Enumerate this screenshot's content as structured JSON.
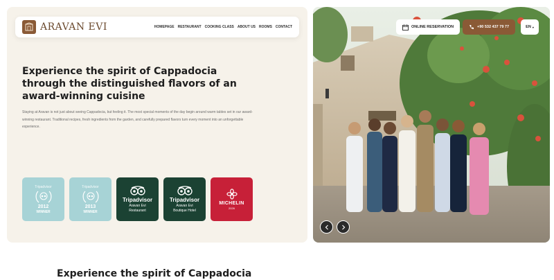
{
  "brand": {
    "name": "ARAVAN EVI"
  },
  "nav": {
    "links": [
      "HOMEPAGE",
      "RESTAURANT",
      "COOKING CLASS",
      "ABOUT US",
      "ROOMS",
      "CONTACT"
    ]
  },
  "hero": {
    "headline": "Experience the spirit of Cappadocia through the distinguished flavors of an award-winning cuisine",
    "intro": "Staying at Aravan is not just about seeing Cappadocia, but feeling it. The most special moments of the day begin around warm tables set in our award-winning restaurant. Traditional recipes, fresh ingredients from the garden, and carefully prepared flavors turn every moment into an unforgettable experience."
  },
  "badges": [
    {
      "top": "Tripadvisor",
      "year": "2012",
      "bottom": "WINNER",
      "style": "light"
    },
    {
      "top": "Tripadvisor",
      "year": "2013",
      "bottom": "WINNER",
      "style": "light"
    },
    {
      "brand": "Tripadvisor",
      "sub1": "Aravan Evi",
      "sub2": "Restaurant",
      "style": "dark"
    },
    {
      "brand": "Tripadvisor",
      "sub1": "Aravan Evi",
      "sub2": "Boutique Hotel",
      "style": "dark"
    },
    {
      "brand": "MICHELIN",
      "sub1": "2026",
      "style": "red"
    }
  ],
  "header_actions": {
    "reservation_label": "ONLINE RESERVATION",
    "phone_label": "+90 532 437 79 77",
    "language": "EN"
  },
  "section": {
    "title": "Experience the spirit of Cappadocia"
  },
  "colors": {
    "brand_brown": "#8a5a36",
    "panel_cream": "#f6f2ea",
    "badge_light": "#a7d3d6",
    "badge_dark": "#1b4233",
    "michelin_red": "#c72038"
  }
}
